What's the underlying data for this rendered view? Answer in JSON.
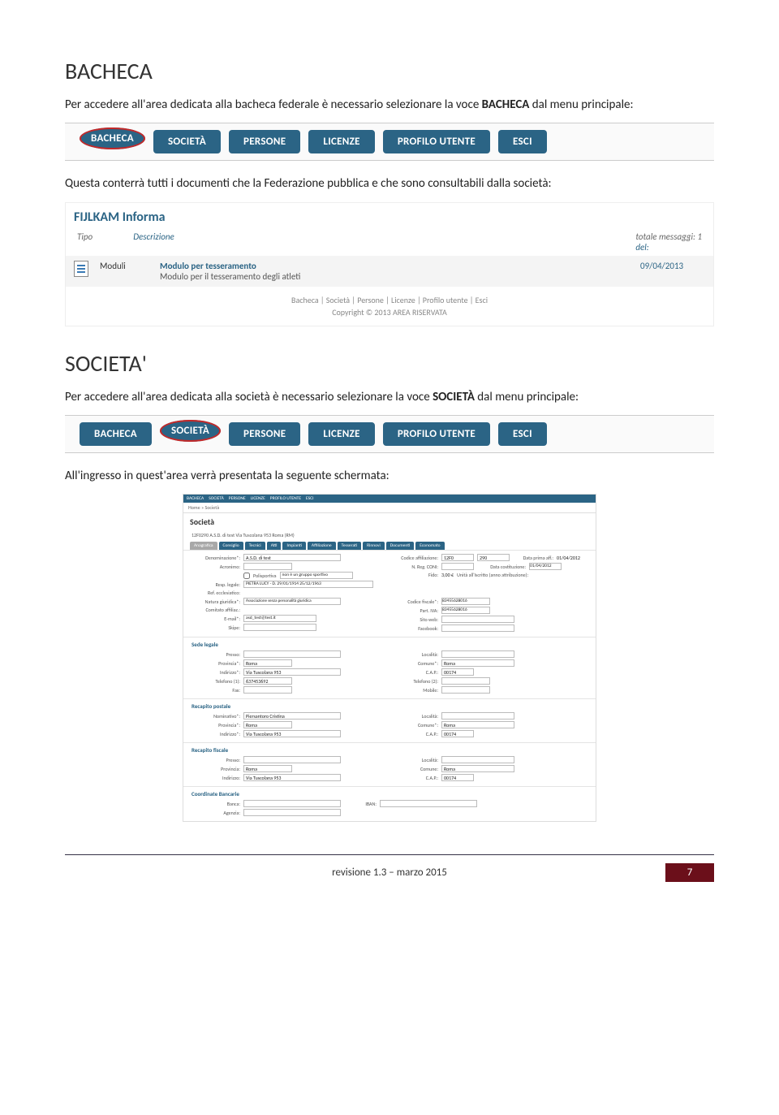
{
  "section1": {
    "heading": "BACHECA",
    "intro_a": "Per accedere all'area dedicata alla bacheca federale è necessario selezionare la voce ",
    "intro_b": "BACHECA",
    "intro_c": " dal menu principale:"
  },
  "nav": {
    "items": [
      "BACHECA",
      "SOCIETÀ",
      "PERSONE",
      "LICENZE",
      "PROFILO UTENTE",
      "ESCI"
    ]
  },
  "para2": "Questa conterrà tutti i documenti che la Federazione pubblica e che sono consultabili dalla società:",
  "panel": {
    "title": "FIJLKAM Informa",
    "total": "totale messaggi: 1",
    "h_tipo": "Tipo",
    "h_descr": "Descrizione",
    "h_del": "del:",
    "row_type": "Moduli",
    "row_title": "Modulo per tesseramento",
    "row_sub": "Modulo per il tesseramento degli atleti",
    "row_date": "09/04/2013",
    "footer_links": "Bacheca | Società | Persone | Licenze | Profilo utente | Esci",
    "copyright": "Copyright © 2013 AREA RISERVATA"
  },
  "section2": {
    "heading": "SOCIETA'",
    "intro_a": "Per accedere all'area dedicata alla società è necessario selezionare la voce ",
    "intro_b": "SOCIETÀ",
    "intro_c": " dal menu principale:"
  },
  "para3": "All'ingresso in quest'area verrà presentata la seguente schermata:",
  "form": {
    "crumb": "Home » Società",
    "title": "Società",
    "sub": "12F0290 A.S.D. di test Via Tuscolana 953 Roma (RM)",
    "tabs": [
      "Anagrafica",
      "Consiglio",
      "Tecnici",
      "Atti",
      "Impianti",
      "Affiliazione",
      "Tesserati",
      "Rinnovi",
      "Documenti",
      "Economato"
    ],
    "r1": {
      "denom_lbl": "Denominazione*:",
      "denom_val": "A.S.D. di test",
      "cod_lbl": "Codice affiliazione:",
      "cod_a": "12F0",
      "cod_b": "290",
      "data_lbl": "Data prima aff.:",
      "data_val": "01/04/2012"
    },
    "r2": {
      "acro_lbl": "Acronimo:",
      "nreg_lbl": "N. Reg. CONI:",
      "datcos_lbl": "Data costituzione:",
      "datcos_val": "01/04/2012"
    },
    "r3": {
      "poli_lbl": "Polisportiva",
      "poli_sel": "non è un gruppo sportivo",
      "fido_lbl": "Fido:",
      "fido_val": "3,00 €",
      "unita_lbl": "Unità all'Iscritto (anno attribuzione):"
    },
    "r4": {
      "lbl": "Resp. legale:",
      "val": "PIETRA LUCY - D. 29/01/1914 25/12/1963"
    },
    "r5": {
      "lbl": "Ref. ecclesiatico:"
    },
    "r6": {
      "nat_lbl": "Natura giuridica*:",
      "nat_val": "Associazione senza personalità giuridica",
      "cf_lbl": "Codice fiscale*:",
      "cf_val": "83455628016"
    },
    "r7": {
      "com_lbl": "Comitato affiliaz.:",
      "piva_lbl": "Part. IVA:",
      "piva_val": "83455628016"
    },
    "r8": {
      "em_lbl": "E-mail*:",
      "em_val": "asd_test@test.it",
      "web_lbl": "Sito web:"
    },
    "r9": {
      "sk_lbl": "Skipe:",
      "fb_lbl": "Facebook:"
    },
    "sede": {
      "title": "Sede legale",
      "presso_lbl": "Presso:",
      "loc_lbl": "Località:",
      "prov_lbl": "Provincia*:",
      "prov_val": "Roma",
      "com_lbl": "Comune*:",
      "com_val": "Roma",
      "ind_lbl": "Indirizzo*:",
      "ind_val": "Via Tuscolana 953",
      "cap_lbl": "C.A.P.:",
      "cap_val": "00174",
      "tel1_lbl": "Telefono (1):",
      "tel1_val": "637453692",
      "tel2_lbl": "Telefono (2):",
      "fax_lbl": "Fax:",
      "mob_lbl": "Mobile:"
    },
    "post": {
      "title": "Recapito postale",
      "nom_lbl": "Nominativo*:",
      "nom_val": "Piersantoro Cristina",
      "loc_lbl": "Località:",
      "prov_lbl": "Provincia*:",
      "prov_val": "Roma",
      "com_lbl": "Comune*:",
      "com_val": "Roma",
      "ind_lbl": "Indirizzo*:",
      "ind_val": "Via Tuscolana 953",
      "cap_lbl": "C.A.P.:",
      "cap_val": "00174"
    },
    "fisc": {
      "title": "Recapito fiscale",
      "presso_lbl": "Presso:",
      "loc_lbl": "Località:",
      "prov_lbl": "Provincia:",
      "prov_val": "Roma",
      "com_lbl": "Comune:",
      "com_val": "Roma",
      "ind_lbl": "Indirizzo:",
      "ind_val": "Via Tuscolana 953",
      "cap_lbl": "C.A.P.:",
      "cap_val": "00174"
    },
    "bank": {
      "title": "Coordinate Bancarie",
      "banca_lbl": "Banca:",
      "iban_lbl": "IBAN:",
      "ag_lbl": "Agenzia:"
    }
  },
  "footer": {
    "rev": "revisione  1.3 – marzo 2015",
    "page": "7"
  }
}
